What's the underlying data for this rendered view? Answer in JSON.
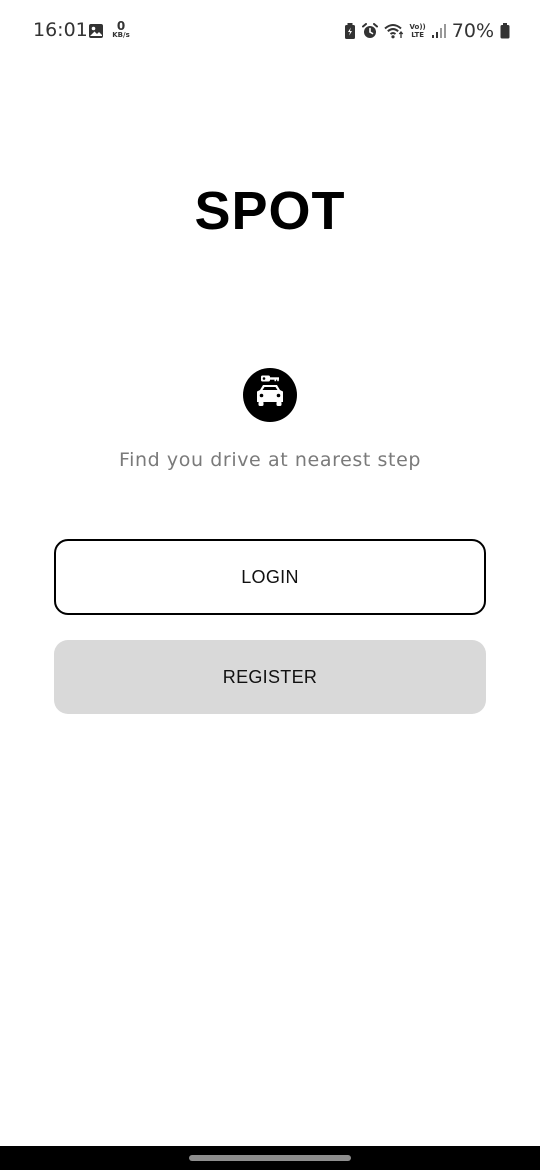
{
  "status_bar": {
    "time": "16:01",
    "net_speed_value": "0",
    "net_speed_unit": "KB/s",
    "volte_line1": "Vo))",
    "volte_line2": "LTE",
    "battery_percent": "70%"
  },
  "app": {
    "title": "SPOT",
    "logo_icon": "car-key-icon",
    "tagline": "Find you drive at nearest step"
  },
  "actions": {
    "login_label": "LOGIN",
    "register_label": "REGISTER"
  },
  "colors": {
    "login_border": "#000000",
    "register_background": "#d9d9d9",
    "tagline_text": "#7a7a7a"
  }
}
